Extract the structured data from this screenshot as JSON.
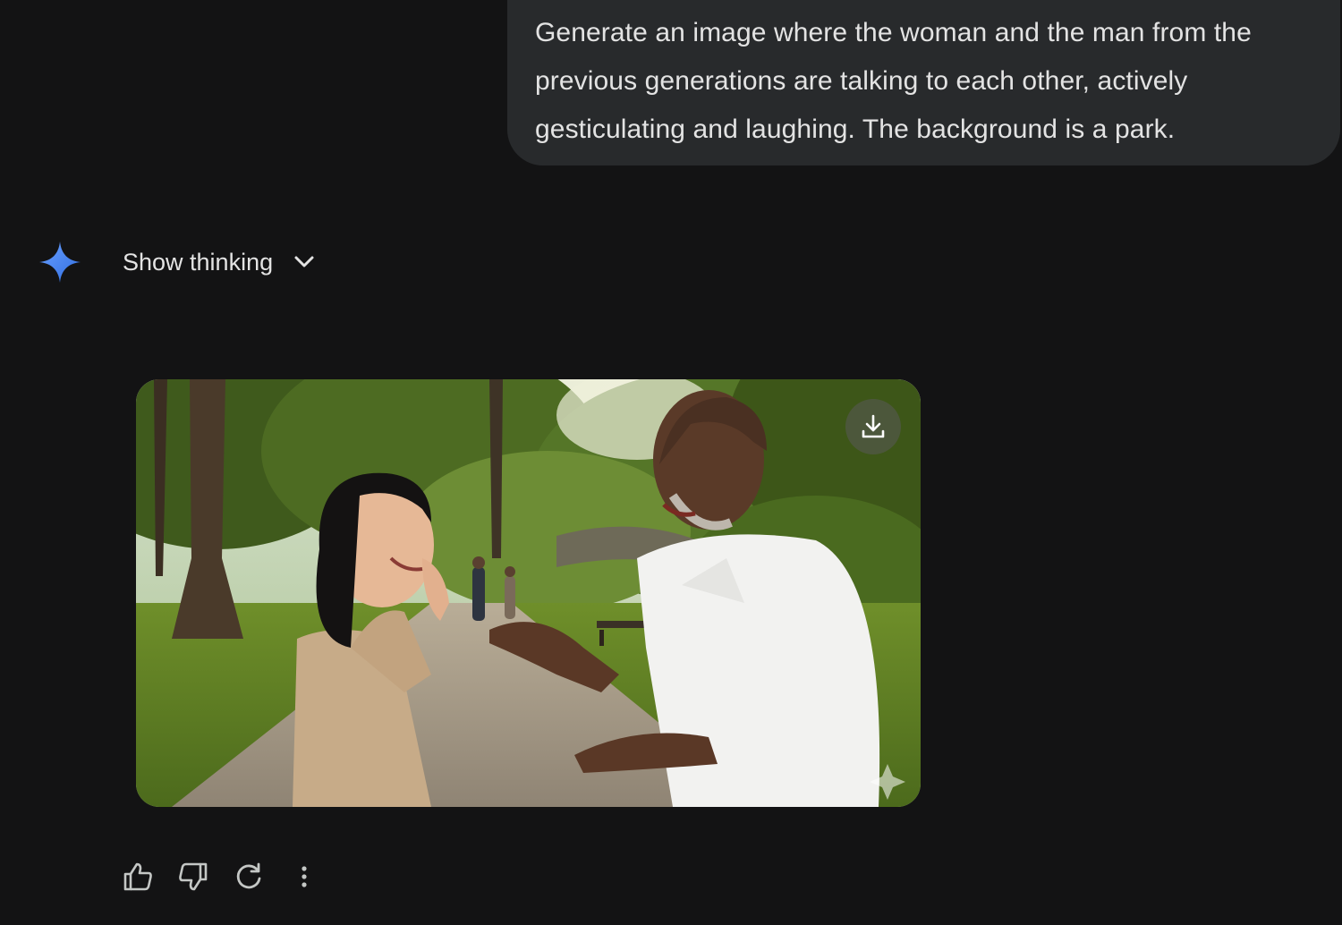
{
  "user_prompt": {
    "text": "Generate an image where the woman and the man from the previous generations are talking to each other, actively gesticulating and laughing. The background is a park."
  },
  "response": {
    "show_thinking_label": "Show thinking",
    "icons": {
      "brand": "gemini-spark-icon",
      "expand": "chevron-down-icon",
      "download": "download-icon"
    },
    "image_subject": "woman and man laughing and gesturing in a park"
  },
  "actions": [
    {
      "icon": "thumbs-up-icon"
    },
    {
      "icon": "thumbs-down-icon"
    },
    {
      "icon": "regenerate-icon"
    },
    {
      "icon": "more-vertical-icon"
    }
  ],
  "colors": {
    "background": "#131314",
    "bubble": "#282a2c",
    "text": "#e3e3e3",
    "accent": "#4f86f7"
  }
}
